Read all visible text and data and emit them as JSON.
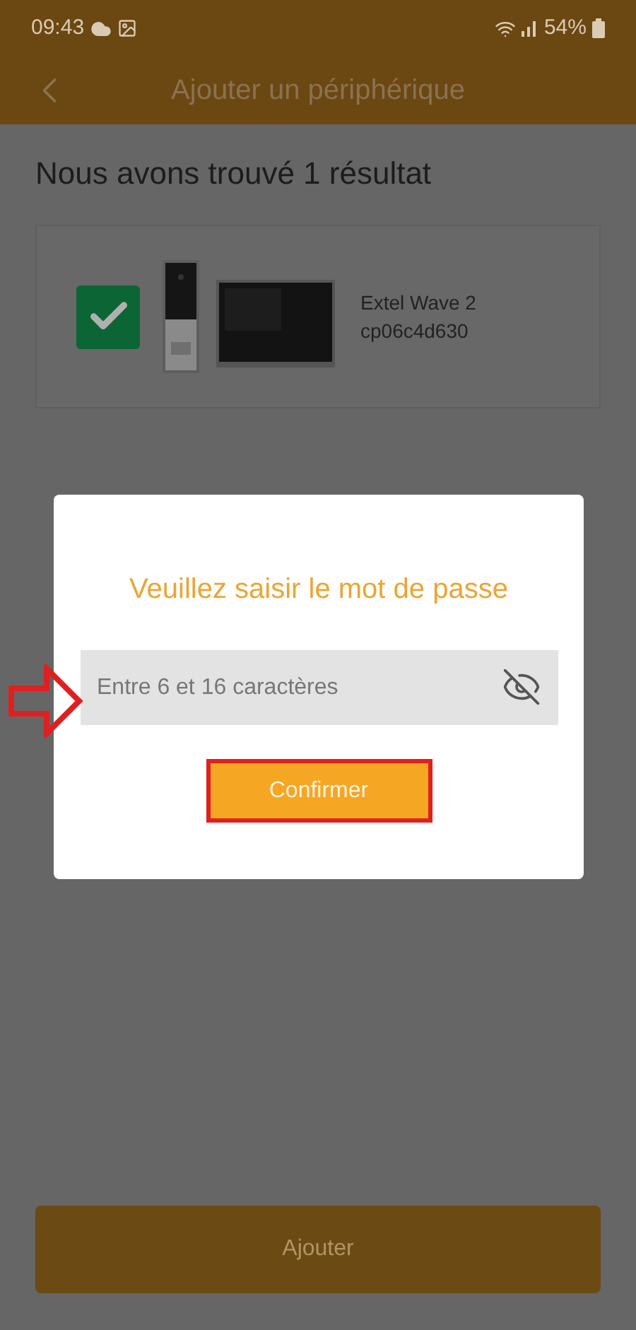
{
  "status_bar": {
    "time": "09:43",
    "battery": "54%"
  },
  "header": {
    "title": "Ajouter un périphérique"
  },
  "result_title": "Nous avons trouvé 1 résultat",
  "devices": [
    {
      "name": "Extel Wave 2",
      "id": "cp06c4d630",
      "checked": true
    }
  ],
  "dialog": {
    "title": "Veuillez saisir le mot de passe",
    "password": {
      "placeholder": "Entre 6 et 16 caractères"
    },
    "confirm": "Confirmer"
  },
  "add_button": "Ajouter"
}
